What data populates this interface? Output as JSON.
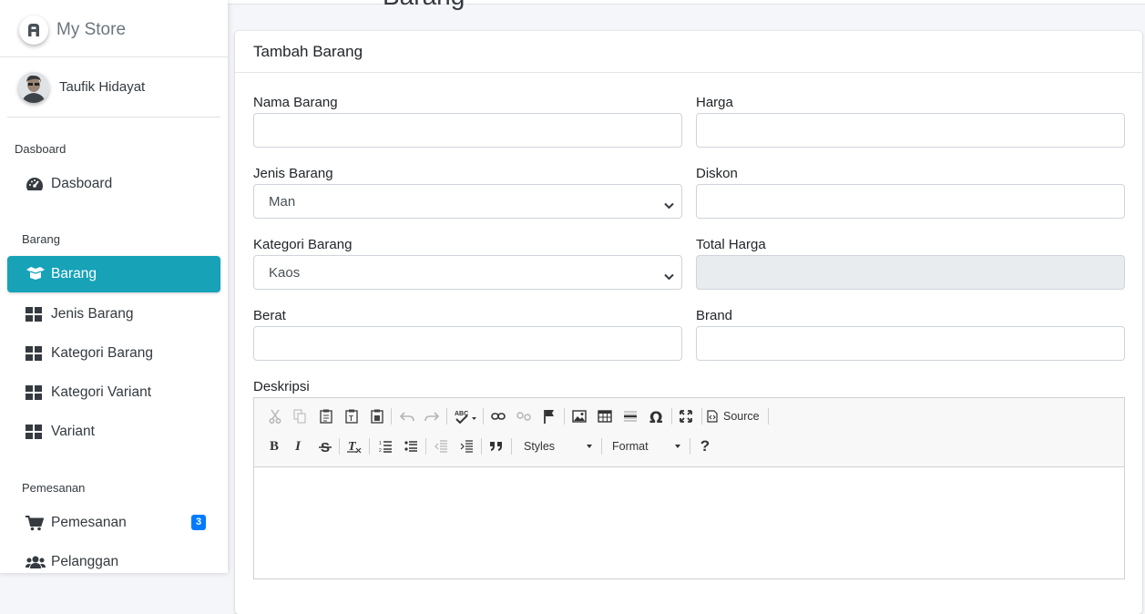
{
  "brand": {
    "name": "My Store"
  },
  "user": {
    "name": "Taufik Hidayat"
  },
  "sidebar": {
    "sections": [
      {
        "header": "Dasboard",
        "items": [
          {
            "label": "Dasboard",
            "icon": "tachometer-icon"
          }
        ]
      },
      {
        "header": "Barang",
        "items": [
          {
            "label": "Barang",
            "icon": "box-open-icon",
            "active": true
          },
          {
            "label": "Jenis Barang",
            "icon": "grid-icon"
          },
          {
            "label": "Kategori Barang",
            "icon": "grid-icon"
          },
          {
            "label": "Kategori Variant",
            "icon": "grid-icon"
          },
          {
            "label": "Variant",
            "icon": "grid-icon"
          }
        ]
      },
      {
        "header": "Pemesanan",
        "items": [
          {
            "label": "Pemesanan",
            "icon": "cart-icon",
            "badge": "3"
          },
          {
            "label": "Pelanggan",
            "icon": "users-icon"
          }
        ]
      }
    ]
  },
  "page": {
    "title": "Barang"
  },
  "card": {
    "title": "Tambah Barang"
  },
  "form": {
    "nama_barang": {
      "label": "Nama Barang",
      "value": ""
    },
    "harga": {
      "label": "Harga",
      "value": ""
    },
    "jenis_barang": {
      "label": "Jenis Barang",
      "selected": "Man"
    },
    "diskon": {
      "label": "Diskon",
      "value": ""
    },
    "kategori_barang": {
      "label": "Kategori Barang",
      "selected": "Kaos"
    },
    "total_harga": {
      "label": "Total Harga",
      "value": ""
    },
    "berat": {
      "label": "Berat",
      "value": ""
    },
    "brand": {
      "label": "Brand",
      "value": ""
    },
    "deskripsi": {
      "label": "Deskripsi"
    }
  },
  "editor": {
    "source_label": "Source",
    "styles_label": "Styles",
    "format_label": "Format",
    "help_label": "?",
    "bold_label": "B",
    "italic_label": "I"
  },
  "colors": {
    "accent": "#17a2b8",
    "badge": "#007bff",
    "readonly_bg": "#e9ecef"
  }
}
